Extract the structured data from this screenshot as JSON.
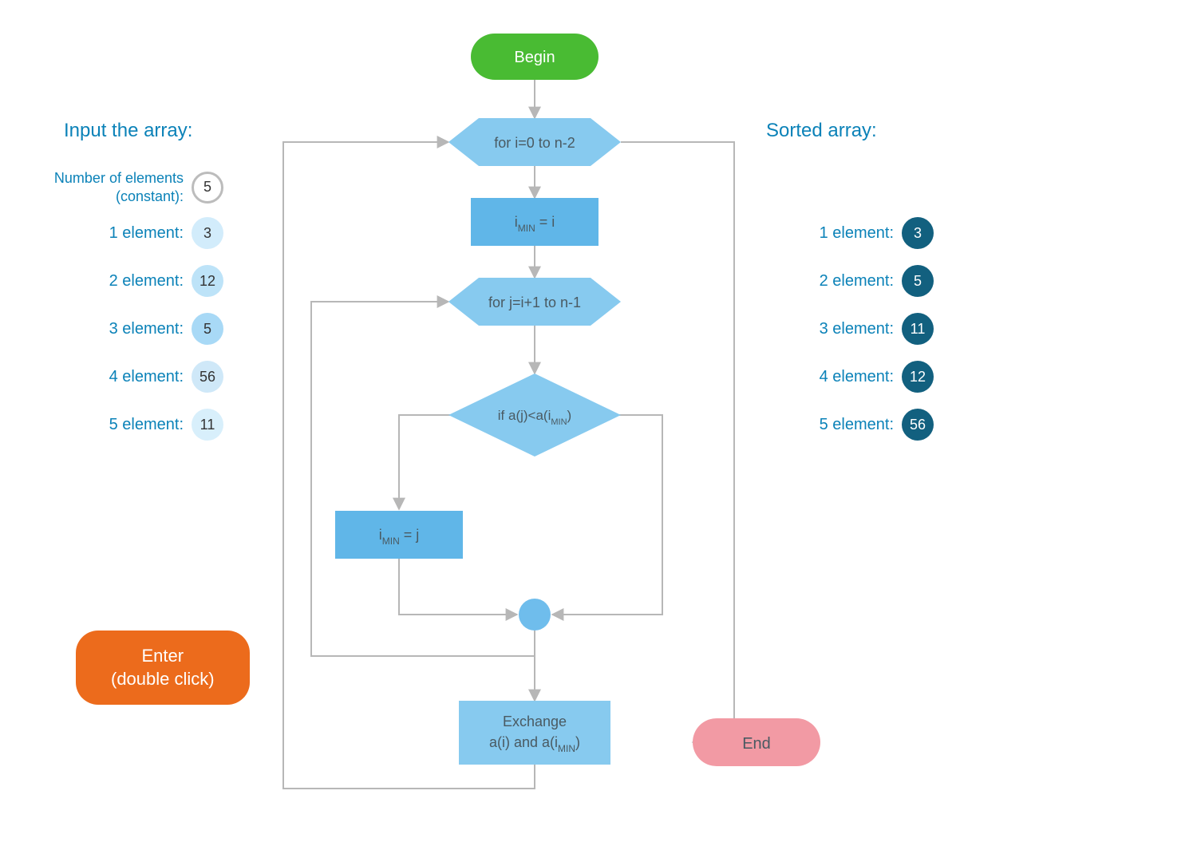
{
  "input": {
    "heading": "Input the array:",
    "count_label": "Number of elements (constant):",
    "count": "5",
    "elements": [
      {
        "label": "1 element:",
        "value": "3"
      },
      {
        "label": "2 element:",
        "value": "12"
      },
      {
        "label": "3 element:",
        "value": "5"
      },
      {
        "label": "4 element:",
        "value": "56"
      },
      {
        "label": "5 element:",
        "value": "11"
      }
    ]
  },
  "output": {
    "heading": "Sorted array:",
    "elements": [
      {
        "label": "1 element:",
        "value": "3"
      },
      {
        "label": "2 element:",
        "value": "5"
      },
      {
        "label": "3 element:",
        "value": "11"
      },
      {
        "label": "4 element:",
        "value": "12"
      },
      {
        "label": "5 element:",
        "value": "56"
      }
    ]
  },
  "button": {
    "line1": "Enter",
    "line2": "(double click)"
  },
  "flow": {
    "begin": "Begin",
    "for_i": "for i=0 to n-2",
    "imin_i_pre": "i",
    "imin_i_sub": "MIN",
    "imin_i_post": " = i",
    "for_j": "for j=i+1 to n-1",
    "cond_pre": "if a(j)<a(i",
    "cond_sub": "MIN",
    "cond_post": ")",
    "imin_j_pre": "i",
    "imin_j_sub": "MIN",
    "imin_j_post": " = j",
    "exch1": "Exchange",
    "exch2_pre": "a(i) and a(i",
    "exch2_sub": "MIN",
    "exch2_post": ")",
    "end": "End"
  }
}
